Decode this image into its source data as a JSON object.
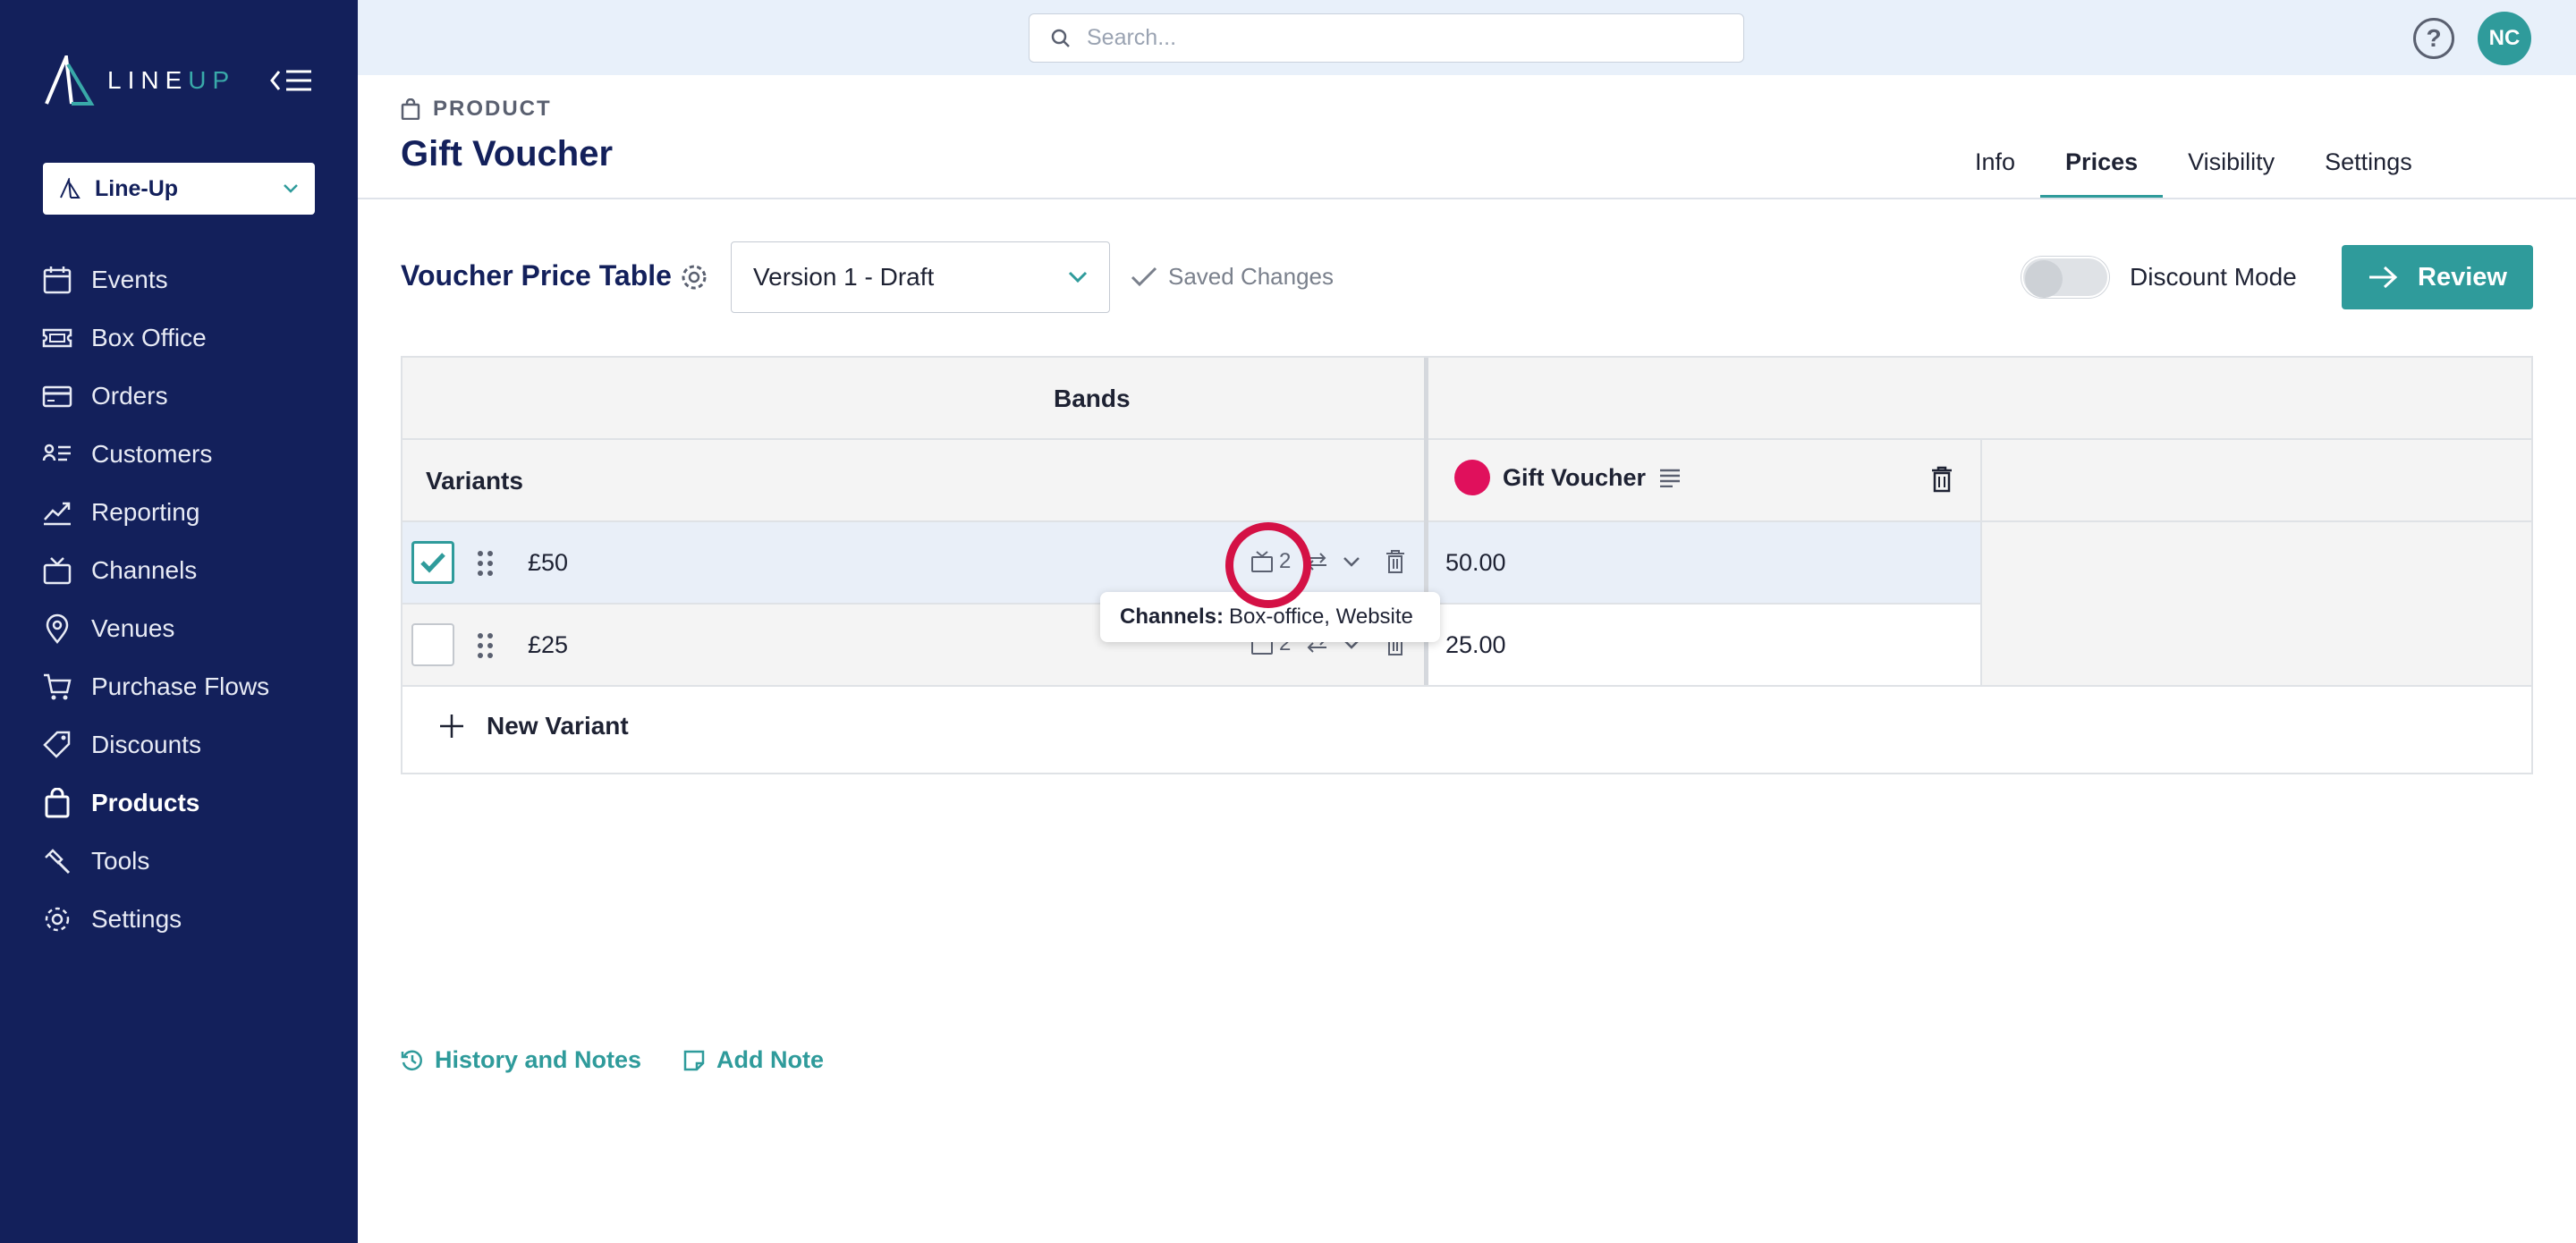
{
  "app": {
    "logo_text_a": "LINE",
    "logo_text_b": "UP",
    "org_selector": "Line-Up"
  },
  "sidebar": {
    "items": [
      {
        "label": "Events",
        "icon": "calendar-icon"
      },
      {
        "label": "Box Office",
        "icon": "ticket-icon"
      },
      {
        "label": "Orders",
        "icon": "card-icon"
      },
      {
        "label": "Customers",
        "icon": "customers-icon"
      },
      {
        "label": "Reporting",
        "icon": "chart-line-icon"
      },
      {
        "label": "Channels",
        "icon": "tv-icon"
      },
      {
        "label": "Venues",
        "icon": "map-pin-icon"
      },
      {
        "label": "Purchase Flows",
        "icon": "cart-icon"
      },
      {
        "label": "Discounts",
        "icon": "tags-icon"
      },
      {
        "label": "Products",
        "icon": "bag-icon",
        "active": true
      },
      {
        "label": "Tools",
        "icon": "hammer-icon"
      },
      {
        "label": "Settings",
        "icon": "gear-icon"
      }
    ]
  },
  "topbar": {
    "search_placeholder": "Search...",
    "help_label": "?",
    "avatar_initials": "NC"
  },
  "header": {
    "crumb": "PRODUCT",
    "title": "Gift Voucher",
    "tabs": [
      "Info",
      "Prices",
      "Visibility",
      "Settings"
    ],
    "active_tab": "Prices"
  },
  "toolbar": {
    "table_title": "Voucher Price Table",
    "version": "Version 1 - Draft",
    "saved_status": "Saved Changes",
    "discount_mode_label": "Discount Mode",
    "discount_mode_on": false,
    "review_label": "Review"
  },
  "table": {
    "bands_header": "Bands",
    "variants_header": "Variants",
    "band_name": "Gift Voucher",
    "band_color": "#e0105c",
    "rows": [
      {
        "label": "£50",
        "channels_count": "2",
        "price": "50.00",
        "checked": true
      },
      {
        "label": "£25",
        "channels_count": "2",
        "price": "25.00",
        "checked": false
      }
    ],
    "new_variant_label": "New Variant"
  },
  "tooltip": {
    "key": "Channels:",
    "value": "Box-office, Website"
  },
  "footer": {
    "history_label": "History and Notes",
    "add_note_label": "Add Note"
  },
  "colors": {
    "sidebar_bg": "#13205b",
    "accent": "#2f9b9b",
    "highlight_ring": "#d41145"
  }
}
